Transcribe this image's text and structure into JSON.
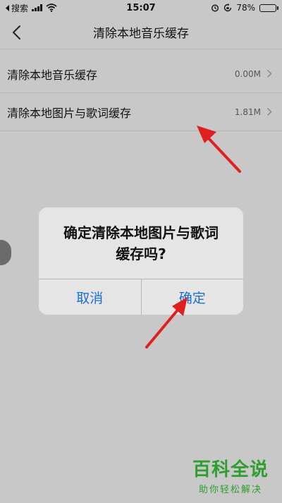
{
  "status_bar": {
    "back_label": "搜索",
    "time": "15:07",
    "battery": "78%",
    "battery_level": 0.78
  },
  "nav": {
    "title": "清除本地音乐缓存"
  },
  "list": {
    "items": [
      {
        "label": "清除本地音乐缓存",
        "size": "0.00M"
      },
      {
        "label": "清除本地图片与歌词缓存",
        "size": "1.81M"
      }
    ]
  },
  "dialog": {
    "message_line1": "确定清除本地图片与歌词",
    "message_line2": "缓存吗?",
    "cancel_label": "取消",
    "confirm_label": "确定",
    "button_color": "#1a6fd6"
  },
  "annotation": {
    "arrow_color": "#e02020"
  },
  "watermark": {
    "title": "百科全说",
    "subtitle": "助你轻松解决"
  }
}
